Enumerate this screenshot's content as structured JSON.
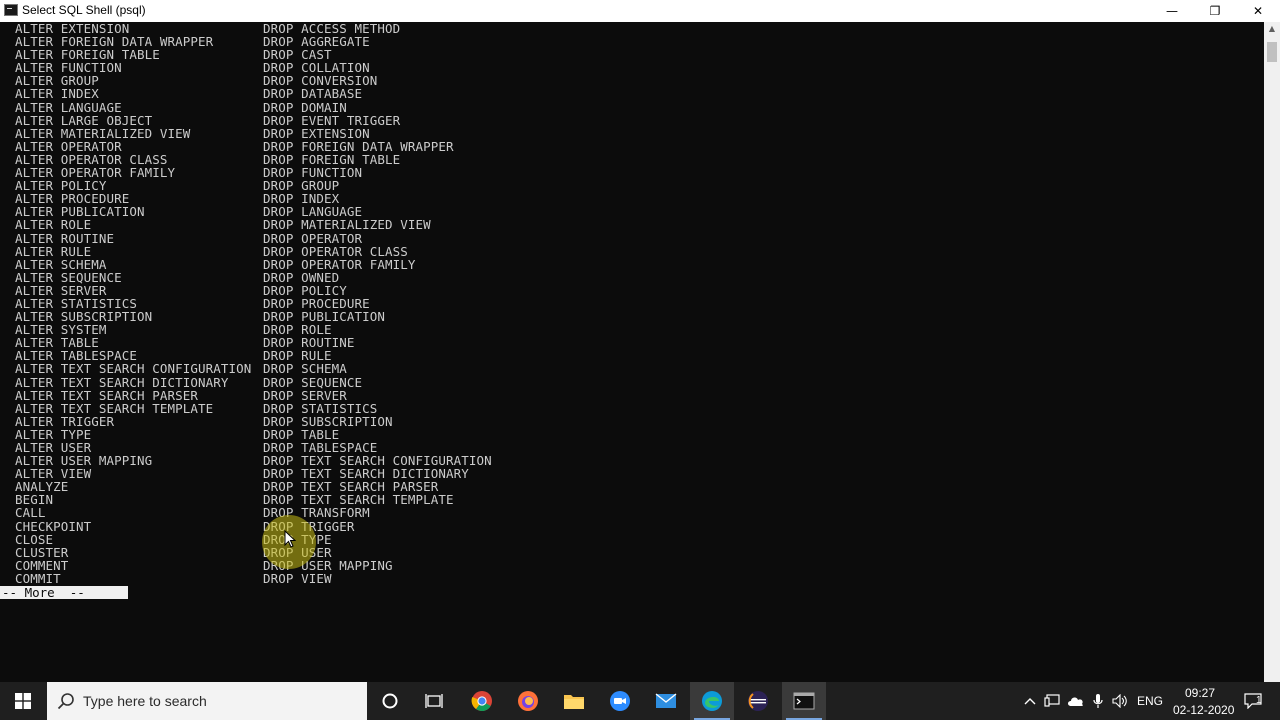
{
  "window": {
    "title": "Select SQL Shell (psql)",
    "min_glyph": "—",
    "max_glyph": "❐",
    "close_glyph": "✕"
  },
  "console": {
    "left_column": [
      "ALTER EXTENSION",
      "ALTER FOREIGN DATA WRAPPER",
      "ALTER FOREIGN TABLE",
      "ALTER FUNCTION",
      "ALTER GROUP",
      "ALTER INDEX",
      "ALTER LANGUAGE",
      "ALTER LARGE OBJECT",
      "ALTER MATERIALIZED VIEW",
      "ALTER OPERATOR",
      "ALTER OPERATOR CLASS",
      "ALTER OPERATOR FAMILY",
      "ALTER POLICY",
      "ALTER PROCEDURE",
      "ALTER PUBLICATION",
      "ALTER ROLE",
      "ALTER ROUTINE",
      "ALTER RULE",
      "ALTER SCHEMA",
      "ALTER SEQUENCE",
      "ALTER SERVER",
      "ALTER STATISTICS",
      "ALTER SUBSCRIPTION",
      "ALTER SYSTEM",
      "ALTER TABLE",
      "ALTER TABLESPACE",
      "ALTER TEXT SEARCH CONFIGURATION",
      "ALTER TEXT SEARCH DICTIONARY",
      "ALTER TEXT SEARCH PARSER",
      "ALTER TEXT SEARCH TEMPLATE",
      "ALTER TRIGGER",
      "ALTER TYPE",
      "ALTER USER",
      "ALTER USER MAPPING",
      "ALTER VIEW",
      "ANALYZE",
      "BEGIN",
      "CALL",
      "CHECKPOINT",
      "CLOSE",
      "CLUSTER",
      "COMMENT",
      "COMMIT"
    ],
    "right_column": [
      "DROP ACCESS METHOD",
      "DROP AGGREGATE",
      "DROP CAST",
      "DROP COLLATION",
      "DROP CONVERSION",
      "DROP DATABASE",
      "DROP DOMAIN",
      "DROP EVENT TRIGGER",
      "DROP EXTENSION",
      "DROP FOREIGN DATA WRAPPER",
      "DROP FOREIGN TABLE",
      "DROP FUNCTION",
      "DROP GROUP",
      "DROP INDEX",
      "DROP LANGUAGE",
      "DROP MATERIALIZED VIEW",
      "DROP OPERATOR",
      "DROP OPERATOR CLASS",
      "DROP OPERATOR FAMILY",
      "DROP OWNED",
      "DROP POLICY",
      "DROP PROCEDURE",
      "DROP PUBLICATION",
      "DROP ROLE",
      "DROP ROUTINE",
      "DROP RULE",
      "DROP SCHEMA",
      "DROP SEQUENCE",
      "DROP SERVER",
      "DROP STATISTICS",
      "DROP SUBSCRIPTION",
      "DROP TABLE",
      "DROP TABLESPACE",
      "DROP TEXT SEARCH CONFIGURATION",
      "DROP TEXT SEARCH DICTIONARY",
      "DROP TEXT SEARCH PARSER",
      "DROP TEXT SEARCH TEMPLATE",
      "DROP TRANSFORM",
      "DROP TRIGGER",
      "DROP TYPE",
      "DROP USER",
      "DROP USER MAPPING",
      "DROP VIEW"
    ],
    "pager_prompt": "-- More  --"
  },
  "taskbar": {
    "search_placeholder": "Type here to search",
    "apps": [
      "cortana-icon",
      "task-view-icon",
      "chrome-icon",
      "firefox-icon",
      "file-explorer-icon",
      "zoom-icon",
      "mail-icon",
      "edge-icon",
      "eclipse-icon",
      "terminal-icon"
    ],
    "language": "ENG",
    "time": "09:27",
    "date": "02-12-2020",
    "notification_count": "1"
  },
  "colors": {
    "console_bg": "#0c0c0c",
    "console_text": "#cccccc",
    "taskbar_bg": "#1f1f1f",
    "highlight": "#c8be14"
  }
}
